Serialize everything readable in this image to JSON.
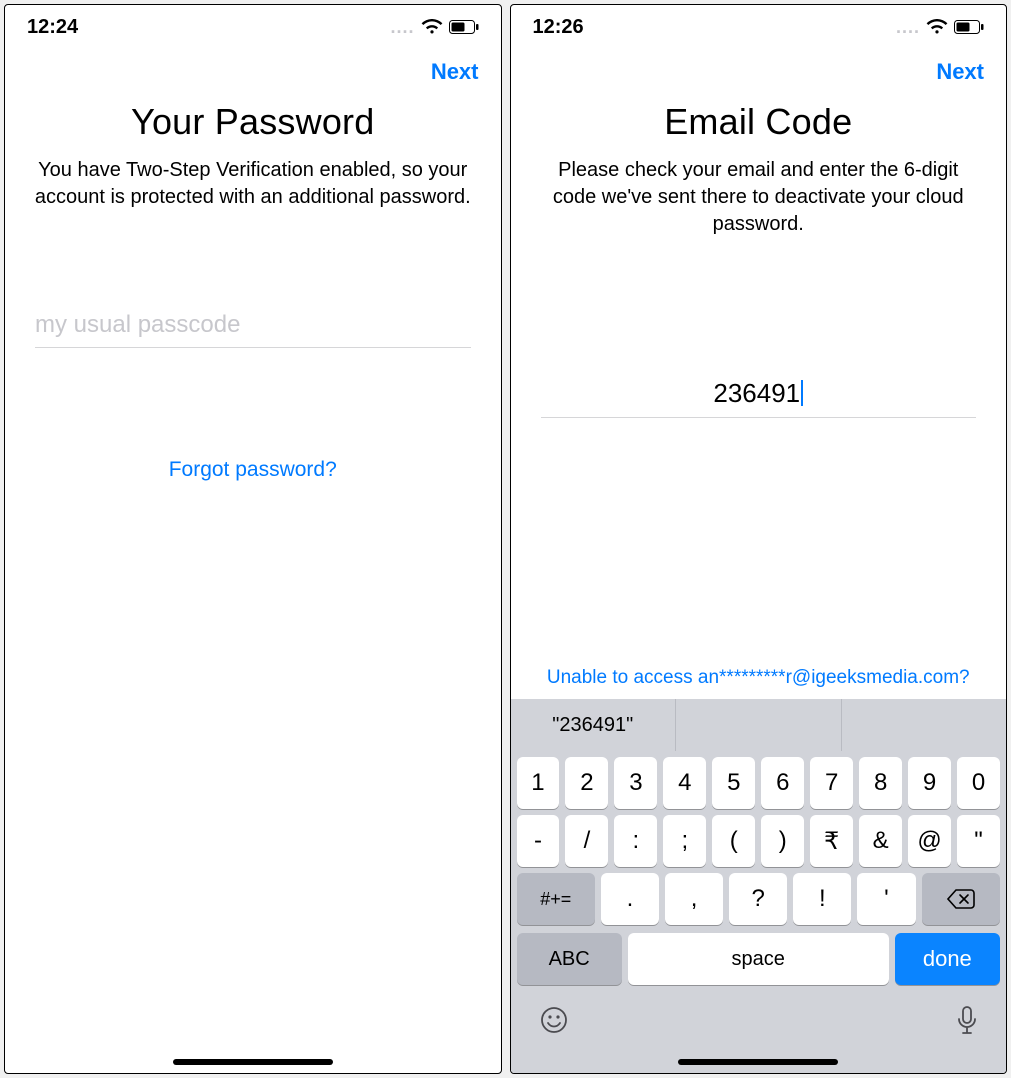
{
  "left": {
    "status": {
      "time": "12:24"
    },
    "nav": {
      "next": "Next"
    },
    "title": "Your Password",
    "subtitle": "You have Two-Step Verification enabled, so your account is protected with an additional password.",
    "password": {
      "placeholder": "my usual passcode",
      "value": ""
    },
    "forgot": "Forgot password?"
  },
  "right": {
    "status": {
      "time": "12:26"
    },
    "nav": {
      "next": "Next"
    },
    "title": "Email Code",
    "subtitle": "Please check your email and enter the 6-digit code we've sent there to deactivate your cloud password.",
    "code": {
      "value": "236491"
    },
    "unable": "Unable to access an*********r@igeeksmedia.com?",
    "keyboard": {
      "suggestion": "\"236491\"",
      "row1": [
        "1",
        "2",
        "3",
        "4",
        "5",
        "6",
        "7",
        "8",
        "9",
        "0"
      ],
      "row2": [
        "-",
        "/",
        ":",
        ";",
        "(",
        ")",
        "₹",
        "&",
        "@",
        "\""
      ],
      "row3_shift": "#+=",
      "row3": [
        ".",
        ",",
        "?",
        "!",
        "'"
      ],
      "row4_abc": "ABC",
      "row4_space": "space",
      "row4_done": "done"
    }
  }
}
